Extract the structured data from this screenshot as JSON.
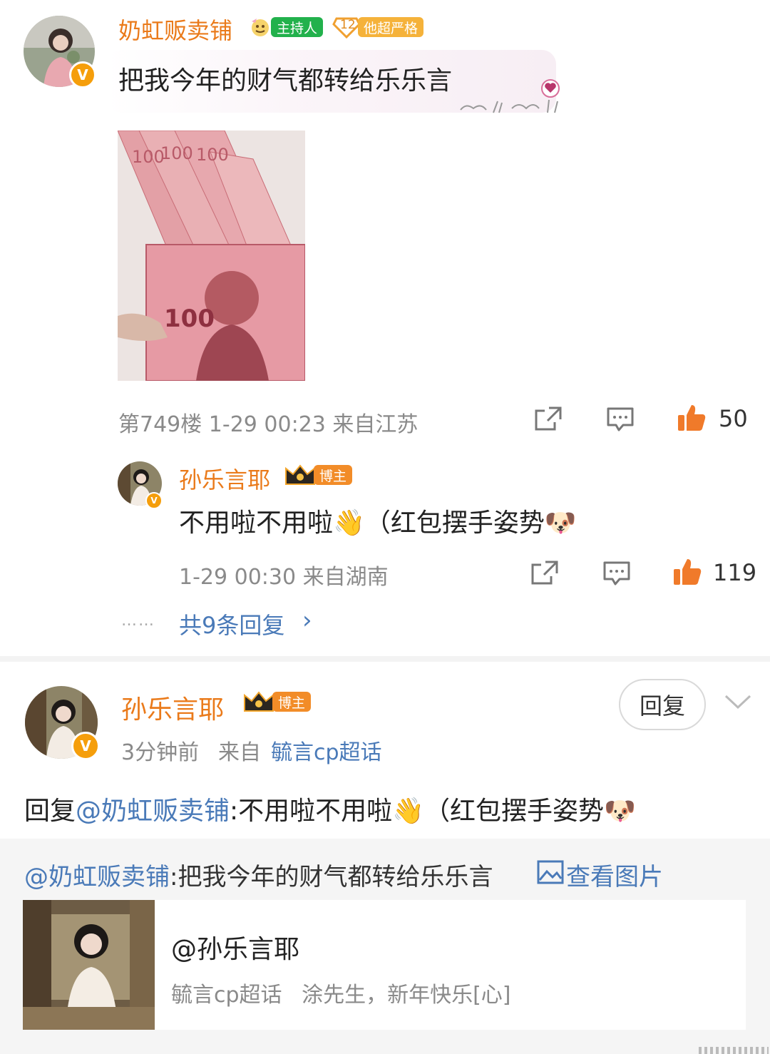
{
  "comment1": {
    "username": "奶虹贩卖铺",
    "badge_host": "主持人",
    "badge_level": "12",
    "badge_strict": "他超严格",
    "text": "把我今年的财气都转给乐乐言",
    "meta": "第749楼 1-29 00:23 来自江苏",
    "like_count": "50"
  },
  "reply1": {
    "username": "孙乐言耶",
    "badge_blogger": "博主",
    "text": "不用啦不用啦👋（红包摆手姿势🐶",
    "meta": "1-29 00:30 来自湖南",
    "like_count": "119"
  },
  "more_replies": {
    "dots": "……",
    "label": "共9条回复",
    "chevron": "›"
  },
  "comment2": {
    "username": "孙乐言耶",
    "badge_blogger": "博主",
    "time": "3分钟前",
    "from_label": "来自",
    "source": "毓言cp超话",
    "reply_button": "回复",
    "text_prefix": "回复",
    "mention": "@奶虹贩卖铺",
    "text_body": ":不用啦不用啦👋（红包摆手姿势🐶",
    "quote_mention": "@奶虹贩卖铺",
    "quote_text": ":把我今年的财气都转给乐乐言",
    "view_image": "查看图片",
    "card_title": "@孙乐言耶",
    "card_topic": "毓言cp超话",
    "card_text": "涂先生，新年快乐[心]"
  },
  "icons": {
    "verified": "verified-v-icon",
    "crown": "crown-icon",
    "share": "share-icon",
    "comment": "comment-icon",
    "like": "thumbs-up-icon",
    "more": "chevron-down-icon",
    "picture": "picture-icon"
  },
  "colors": {
    "username": "#ea7a1a",
    "link": "#4a7ab8",
    "like": "#f07a2a",
    "host_badge": "#22b14c",
    "blogger_badge": "#f28c28"
  }
}
